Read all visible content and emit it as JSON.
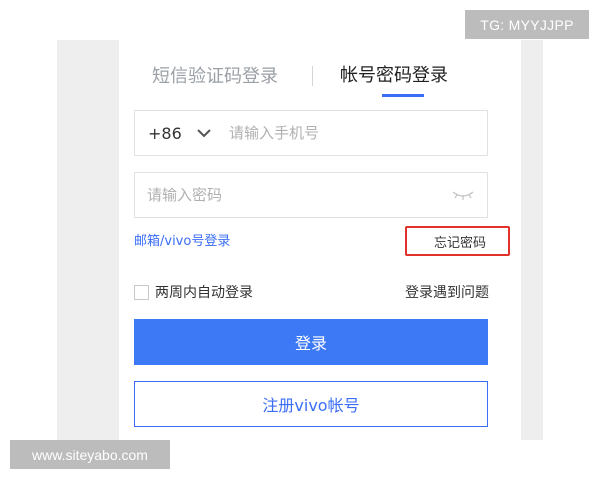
{
  "watermarks": {
    "top_right": "TG: MYYJJPP",
    "bottom_left": "www.siteyabo.com"
  },
  "tabs": {
    "sms": "短信验证码登录",
    "password": "帐号密码登录",
    "active": "password"
  },
  "phone_field": {
    "country_code": "+86",
    "placeholder": "请输入手机号",
    "value": ""
  },
  "password_field": {
    "placeholder": "请输入密码",
    "value": ""
  },
  "links": {
    "email_login": "邮箱/vivo号登录",
    "forgot_password": "忘记密码",
    "login_trouble": "登录遇到问题"
  },
  "auto_login": {
    "label": "两周内自动登录",
    "checked": false
  },
  "buttons": {
    "login": "登录",
    "register": "注册vivo帐号"
  },
  "colors": {
    "accent": "#3e79f5",
    "highlight_box": "#e0312b"
  }
}
